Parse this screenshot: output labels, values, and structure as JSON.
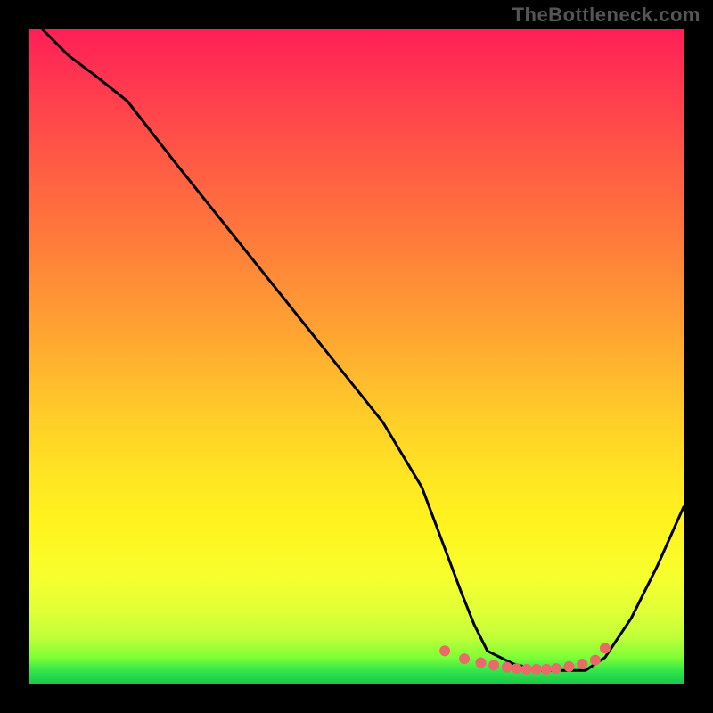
{
  "watermark": "TheBottleneck.com",
  "chart_data": {
    "type": "line",
    "title": "",
    "xlabel": "",
    "ylabel": "",
    "xlim": [
      0,
      100
    ],
    "ylim": [
      0,
      100
    ],
    "note": "Axes are unlabeled in the source image; x/y expressed as estimated percentages of plot width/height (y=0 at bottom).",
    "series": [
      {
        "name": "curve",
        "color": "#000000",
        "x": [
          2,
          6,
          10,
          15,
          22,
          30,
          38,
          46,
          54,
          60,
          63,
          66,
          68,
          70,
          74,
          78,
          82,
          85,
          88,
          92,
          96,
          100
        ],
        "y": [
          100,
          96,
          93,
          89,
          80,
          70,
          60,
          50,
          40,
          30,
          22,
          14,
          9,
          5,
          3,
          2,
          2,
          2,
          4,
          10,
          18,
          27
        ]
      }
    ],
    "markers": {
      "name": "dots",
      "color": "#ea6a6a",
      "x": [
        63.5,
        66.5,
        69.0,
        71.0,
        73.0,
        74.5,
        76.0,
        77.5,
        79.0,
        80.5,
        82.5,
        84.5,
        86.5,
        88.0
      ],
      "y": [
        5.0,
        3.8,
        3.2,
        2.8,
        2.5,
        2.3,
        2.2,
        2.2,
        2.2,
        2.3,
        2.6,
        3.0,
        3.6,
        5.4
      ]
    },
    "background_gradient": {
      "top": "#ff1f57",
      "upper_mid": "#ff7a3b",
      "mid": "#ffe523",
      "lower": "#bfff38",
      "bottom": "#18c94a"
    }
  }
}
